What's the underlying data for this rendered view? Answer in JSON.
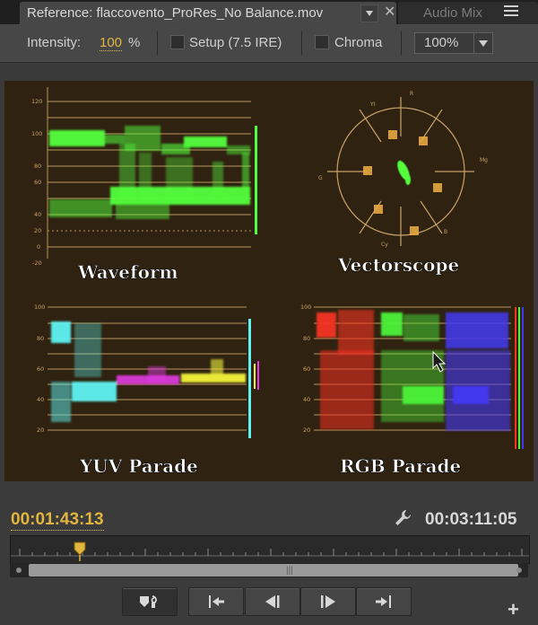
{
  "tabs": {
    "active_title": "Reference: flaccovento_ProRes_No Balance.mov",
    "other_title": "Audio Mix"
  },
  "toolbar": {
    "intensity_label": "Intensity:",
    "intensity_value": "100",
    "intensity_unit": "%",
    "setup_label": "Setup (7.5 IRE)",
    "setup_checked": false,
    "chroma_label": "Chroma",
    "chroma_checked": false,
    "zoom_value": "100%"
  },
  "scopes": {
    "labels": {
      "waveform": "Waveform",
      "vectorscope": "Vectorscope",
      "yuv_parade": "YUV Parade",
      "rgb_parade": "RGB Parade"
    },
    "waveform_ticks": [
      "120",
      "100",
      "80",
      "60",
      "40",
      "20",
      "0",
      "-20"
    ],
    "parade_ticks": [
      "100",
      "80",
      "60",
      "40",
      "20"
    ],
    "vectorscope_labels": [
      "R",
      "Mg",
      "B",
      "Cy",
      "G",
      "YI"
    ],
    "colors": {
      "graticule": "#c9a36a",
      "luma": "#52ff3c",
      "cyan": "#5ef2f2",
      "magenta": "#e23ae2",
      "yellow": "#f2f23a",
      "red": "#f23222",
      "green": "#4cf23a",
      "blue": "#4238f2"
    }
  },
  "timebar": {
    "current_time": "00:01:43:13",
    "duration": "00:03:11:05"
  },
  "controls": {
    "icons": [
      "insert-overlay-icon",
      "step-to-in-icon",
      "step-back-icon",
      "step-forward-icon",
      "step-to-out-icon"
    ]
  }
}
